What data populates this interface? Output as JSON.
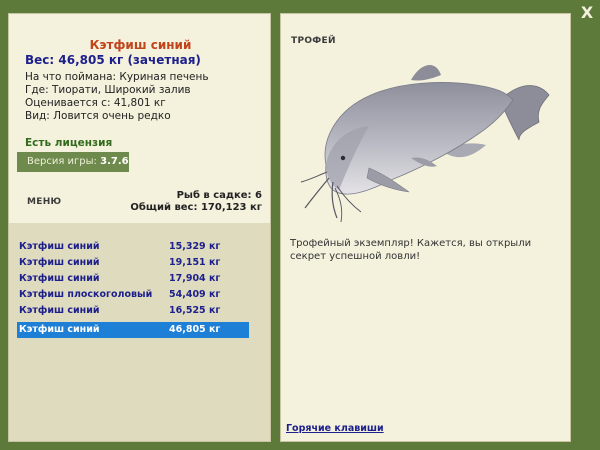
{
  "close_label": "X",
  "fish": {
    "name": "Кэтфиш синий",
    "weight_line": "Вес: 46,805 кг (зачетная)",
    "bait": "На что поймана: Куриная печень",
    "location": "Где: Тиорати, Широкий залив",
    "value": "Оценивается с: 41,801 кг",
    "rarity": "Вид: Ловится очень редко"
  },
  "license_label": "Есть лицензия",
  "version": {
    "prefix": "Версия игры:",
    "number": "3.7.6"
  },
  "menu_label": "меню",
  "cage": {
    "count_line": "Рыб в садке: 6",
    "total_line": "Общий вес: 170,123 кг"
  },
  "catches": [
    {
      "name": "Кэтфиш синий",
      "weight": "15,329 кг"
    },
    {
      "name": "Кэтфиш синий",
      "weight": "19,151 кг"
    },
    {
      "name": "Кэтфиш синий",
      "weight": "17,904 кг"
    },
    {
      "name": "Кэтфиш плоскоголовый",
      "weight": "54,409 кг"
    },
    {
      "name": "Кэтфиш синий",
      "weight": "16,525 кг"
    },
    {
      "name": "Кэтфиш синий",
      "weight": "46,805 кг"
    }
  ],
  "selected_index": 5,
  "trophy": {
    "label": "ТРОФЕЙ",
    "description": "Трофейный экземпляр! Кажется, вы открыли секрет успешной ловли!"
  },
  "hotkeys_label": "Горячие клавиши",
  "colors": {
    "background": "#5d7a3a",
    "panel": "#f4f1dd",
    "title": "#c0441c",
    "list_text": "#1c1f8c",
    "selection": "#1e7fd6"
  }
}
